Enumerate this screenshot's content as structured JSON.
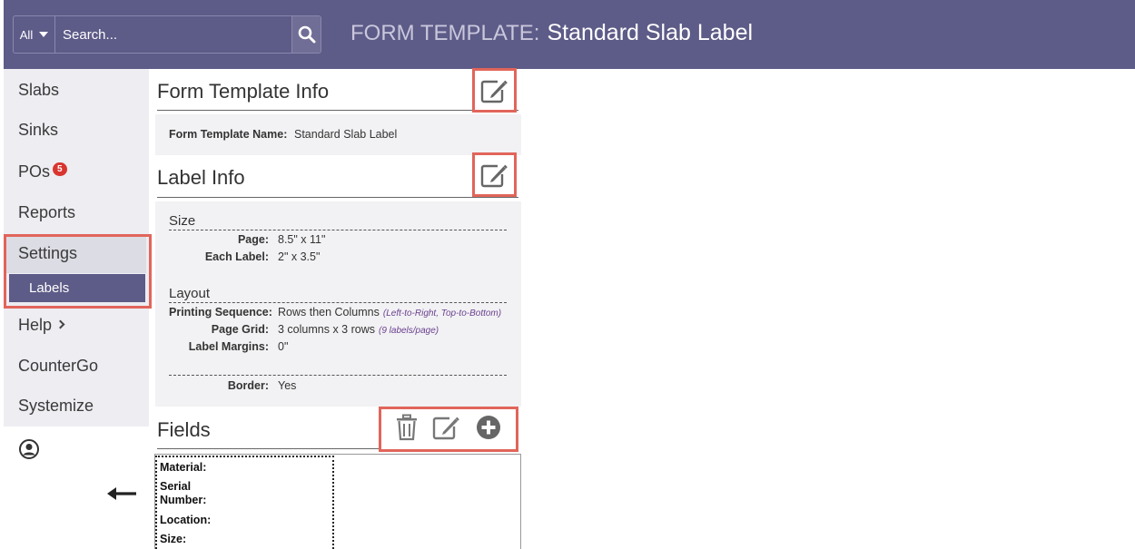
{
  "header": {
    "search_scope": "All",
    "search_placeholder": "Search...",
    "title_prefix": "FORM TEMPLATE:",
    "title": "Standard Slab Label"
  },
  "sidebar": {
    "items": [
      {
        "label": "Slabs"
      },
      {
        "label": "Sinks"
      },
      {
        "label": "POs",
        "badge": "5"
      },
      {
        "label": "Reports"
      },
      {
        "label": "Settings"
      },
      {
        "label": "Labels"
      },
      {
        "label": "Help"
      },
      {
        "label": "CounterGo"
      },
      {
        "label": "Systemize"
      }
    ]
  },
  "form_template_info": {
    "title": "Form Template Info",
    "name_label": "Form Template Name:",
    "name_value": "Standard Slab Label"
  },
  "label_info": {
    "title": "Label Info",
    "size": {
      "heading": "Size",
      "page_label": "Page:",
      "page_value": "8.5\" x 11\"",
      "each_label": "Each Label:",
      "each_value": "2\" x 3.5\""
    },
    "layout": {
      "heading": "Layout",
      "sequence_label": "Printing Sequence:",
      "sequence_value": "Rows then Columns",
      "sequence_note": "(Left-to-Right, Top-to-Bottom)",
      "grid_label": "Page Grid:",
      "grid_value": "3 columns x 3 rows",
      "grid_note": "(9 labels/page)",
      "margins_label": "Label Margins:",
      "margins_value": "0\""
    },
    "border_label": "Border:",
    "border_value": "Yes"
  },
  "fields": {
    "title": "Fields",
    "items": [
      {
        "label": "Material:"
      },
      {
        "label": "Serial Number:"
      },
      {
        "label": "Location:"
      },
      {
        "label": "Size:"
      }
    ]
  },
  "colors": {
    "header_bg": "#5d5b87",
    "highlight": "#e1655a",
    "badge": "#d9352f"
  }
}
